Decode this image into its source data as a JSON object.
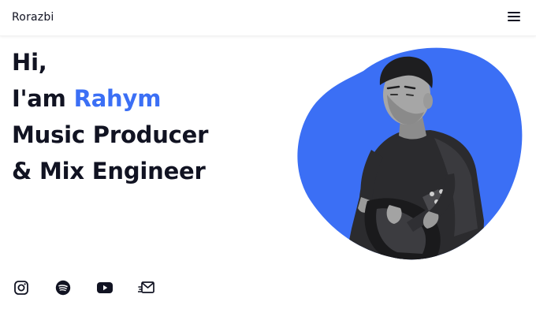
{
  "header": {
    "logo": "Rorazbi",
    "menu_icon": "hamburger-menu-icon"
  },
  "hero": {
    "greeting": "Hi,",
    "intro_prefix": "I'am ",
    "name": "Rahym",
    "role_line_1": "Music Producer",
    "role_line_2": "& Mix Engineer",
    "accent_color": "#3b6ff5",
    "image_alt": "Guitarist portrait"
  },
  "socials": [
    {
      "icon": "instagram-icon"
    },
    {
      "icon": "spotify-icon"
    },
    {
      "icon": "youtube-icon"
    },
    {
      "icon": "email-icon"
    }
  ]
}
